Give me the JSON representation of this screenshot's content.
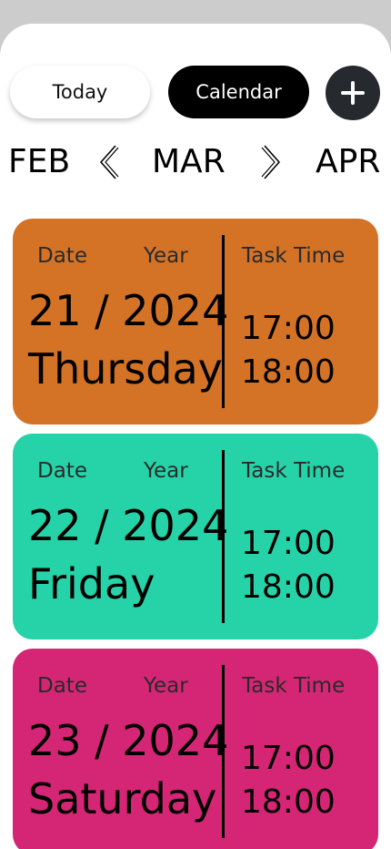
{
  "header": {
    "today_label": "Today",
    "calendar_label": "Calendar",
    "add_icon": "plus-icon"
  },
  "month_nav": {
    "prev": "FEB",
    "current": "MAR",
    "next": "APR",
    "prev_icon": "chevron-left-icon",
    "next_icon": "chevron-right-icon"
  },
  "labels": {
    "date": "Date",
    "year": "Year",
    "task_time": "Task Time"
  },
  "cards": [
    {
      "date_year": "21 / 2024",
      "weekday": "Thursday",
      "times": [
        "17:00",
        "18:00"
      ],
      "color": "#d47326"
    },
    {
      "date_year": "22 / 2024",
      "weekday": "Friday",
      "times": [
        "17:00",
        "18:00"
      ],
      "color": "#26d3a8"
    },
    {
      "date_year": "23 / 2024",
      "weekday": "Saturday",
      "times": [
        "17:00",
        "18:00"
      ],
      "color": "#d42675"
    }
  ]
}
